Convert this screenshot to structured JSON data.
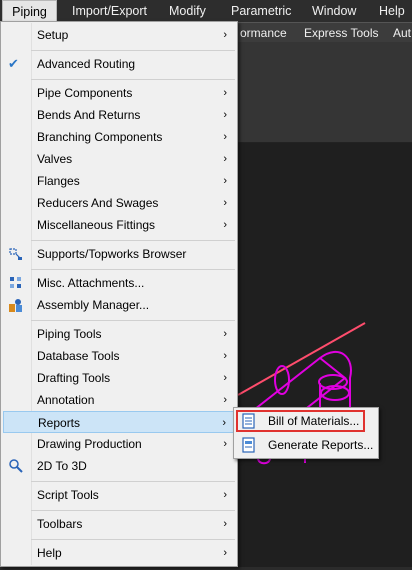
{
  "menubar": {
    "items": [
      "Piping",
      "Import/Export",
      "Modify",
      "Parametric",
      "Window",
      "Help"
    ]
  },
  "ribbon": {
    "tabs": [
      "ormance",
      "Express Tools",
      "Aut"
    ]
  },
  "menu": {
    "items": [
      {
        "label": "Setup",
        "submenu": true
      },
      {
        "label": "Advanced Routing",
        "checked": true
      },
      {
        "label": "Pipe Components",
        "submenu": true
      },
      {
        "label": "Bends And Returns",
        "submenu": true
      },
      {
        "label": "Branching Components",
        "submenu": true
      },
      {
        "label": "Valves",
        "submenu": true
      },
      {
        "label": "Flanges",
        "submenu": true
      },
      {
        "label": "Reducers And Swages",
        "submenu": true
      },
      {
        "label": "Miscellaneous Fittings",
        "submenu": true
      },
      {
        "label": "Supports/Topworks Browser"
      },
      {
        "label": "Misc. Attachments..."
      },
      {
        "label": "Assembly Manager..."
      },
      {
        "label": "Piping Tools",
        "submenu": true
      },
      {
        "label": "Database Tools",
        "submenu": true
      },
      {
        "label": "Drafting Tools",
        "submenu": true
      },
      {
        "label": "Annotation",
        "submenu": true
      },
      {
        "label": "Reports",
        "submenu": true,
        "highlighted": true
      },
      {
        "label": "Drawing Production",
        "submenu": true
      },
      {
        "label": "2D To 3D"
      },
      {
        "label": "Script Tools",
        "submenu": true
      },
      {
        "label": "Toolbars",
        "submenu": true
      },
      {
        "label": "Help",
        "submenu": true
      }
    ],
    "submenu_arrow": "›",
    "checkmark": "✔"
  },
  "submenu": {
    "items": [
      {
        "label": "Bill of Materials...",
        "selected": true
      },
      {
        "label": "Generate Reports..."
      }
    ]
  },
  "colors": {
    "menu_bg": "#f0f0f0",
    "highlight": "#cce4f7",
    "accent_red": "#e0322f",
    "magenta": "#e000e0"
  }
}
